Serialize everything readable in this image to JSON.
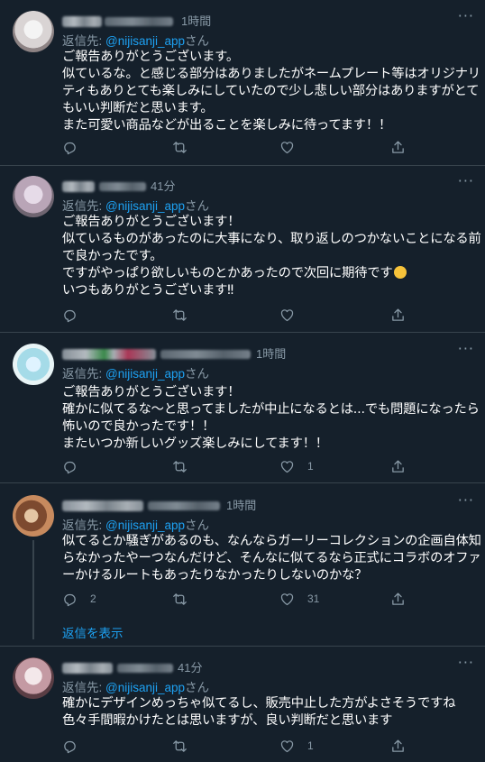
{
  "reply_prefix": "返信先: ",
  "reply_suffix": "さん",
  "mention": "@nijisanji_app",
  "show_replies": "返信を表示",
  "tweets": [
    {
      "time": "1時間",
      "lines": [
        "ご報告ありがとうございます。",
        "似ているな。と感じる部分はありましたがネームプレート等はオリジナリ",
        "ティもありとても楽しみにしていたので少し悲しい部分はありますがとて",
        "もいい判断だと思います。",
        "また可愛い商品などが出ることを楽しみに待ってます！！"
      ],
      "replies": "",
      "retweets": "",
      "likes": ""
    },
    {
      "time": "41分",
      "lines": [
        "ご報告ありがとうございます！",
        "似ているものがあったのに大事になり、取り返しのつかないことになる前",
        "で良かったです。",
        "ですがやっぱり欲しいものとかあったので次回に期待です",
        "いつもありがとうございます‼"
      ],
      "replies": "",
      "retweets": "",
      "likes": ""
    },
    {
      "time": "1時間",
      "lines": [
        "ご報告ありがとうございます！",
        "確かに似てるな〜と思ってましたが中止になるとは...でも問題になったら",
        "怖いので良かったです！！",
        "またいつか新しいグッズ楽しみにしてます！！"
      ],
      "replies": "",
      "retweets": "",
      "likes": "1"
    },
    {
      "time": "1時間",
      "lines": [
        "似てるとか騒ぎがあるのも、なんならガーリーコレクションの企画自体知",
        "らなかったやーつなんだけど、そんなに似てるなら正式にコラボのオファ",
        "ーかけるルートもあったりなかったりしないのかな？"
      ],
      "replies": "2",
      "retweets": "",
      "likes": "31"
    },
    {
      "time": "41分",
      "lines": [
        "確かにデザインめっちゃ似てるし、販売中止した方がよさそうですね",
        "色々手間暇かけたとは思いますが、良い判断だと思います"
      ],
      "replies": "",
      "retweets": "",
      "likes": "1"
    }
  ]
}
